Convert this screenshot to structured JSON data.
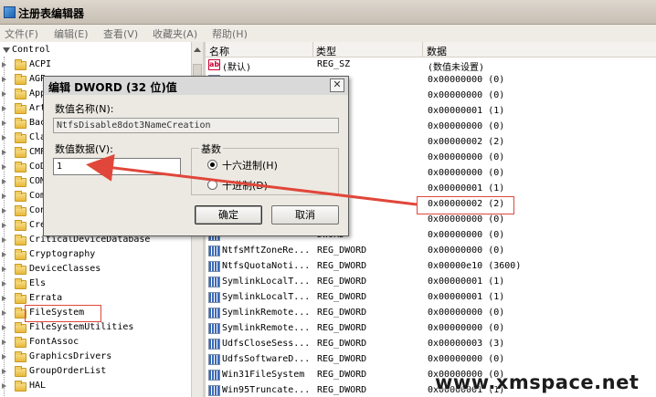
{
  "window": {
    "title": "注册表编辑器"
  },
  "menu": [
    "文件(F)",
    "编辑(E)",
    "查看(V)",
    "收藏夹(A)",
    "帮助(H)"
  ],
  "tree": {
    "root": "Control",
    "items": [
      "ACPI",
      "AGP",
      "App",
      "Art",
      "Bac",
      "Cla",
      "CMF",
      "CoD",
      "COM",
      "Com",
      "Con",
      "Cre",
      "CriticalDeviceDatabase",
      "Cryptography",
      "DeviceClasses",
      "Els",
      "Errata",
      "FileSystem",
      "FileSystemUtilities",
      "FontAssoc",
      "GraphicsDrivers",
      "GroupOrderList",
      "HAL"
    ],
    "selected": "FileSystem"
  },
  "columns": {
    "name": "名称",
    "type": "类型",
    "data": "数据"
  },
  "values": [
    {
      "name": "(默认)",
      "type": "REG_SZ",
      "data": "(数值未设置)",
      "icon": "string"
    },
    {
      "name": "",
      "type": "DWORD",
      "data": "0x00000000 (0)",
      "icon": "dword"
    },
    {
      "name": "",
      "type": "DWORD",
      "data": "0x00000000 (0)",
      "icon": "dword"
    },
    {
      "name": "",
      "type": "DWORD",
      "data": "0x00000001 (1)",
      "icon": "dword"
    },
    {
      "name": "",
      "type": "DWORD",
      "data": "0x00000000 (0)",
      "icon": "dword"
    },
    {
      "name": "",
      "type": "DWORD",
      "data": "0x00000002 (2)",
      "icon": "dword"
    },
    {
      "name": "",
      "type": "DWORD",
      "data": "0x00000000 (0)",
      "icon": "dword"
    },
    {
      "name": "",
      "type": "DWORD",
      "data": "0x00000000 (0)",
      "icon": "dword"
    },
    {
      "name": "",
      "type": "DWORD",
      "data": "0x00000001 (1)",
      "icon": "dword"
    },
    {
      "name": "",
      "type": "DWORD",
      "data": "0x00000002 (2)",
      "icon": "dword"
    },
    {
      "name": "",
      "type": "DWORD",
      "data": "0x00000000 (0)",
      "icon": "dword"
    },
    {
      "name": "",
      "type": "DWORD",
      "data": "0x00000000 (0)",
      "icon": "dword"
    },
    {
      "name": "NtfsMftZoneRe...",
      "type": "REG_DWORD",
      "data": "0x00000000 (0)",
      "icon": "dword"
    },
    {
      "name": "NtfsQuotaNoti...",
      "type": "REG_DWORD",
      "data": "0x00000e10 (3600)",
      "icon": "dword"
    },
    {
      "name": "SymlinkLocalT...",
      "type": "REG_DWORD",
      "data": "0x00000001 (1)",
      "icon": "dword"
    },
    {
      "name": "SymlinkLocalT...",
      "type": "REG_DWORD",
      "data": "0x00000001 (1)",
      "icon": "dword"
    },
    {
      "name": "SymlinkRemote...",
      "type": "REG_DWORD",
      "data": "0x00000000 (0)",
      "icon": "dword"
    },
    {
      "name": "SymlinkRemote...",
      "type": "REG_DWORD",
      "data": "0x00000000 (0)",
      "icon": "dword"
    },
    {
      "name": "UdfsCloseSess...",
      "type": "REG_DWORD",
      "data": "0x00000003 (3)",
      "icon": "dword"
    },
    {
      "name": "UdfsSoftwareD...",
      "type": "REG_DWORD",
      "data": "0x00000000 (0)",
      "icon": "dword"
    },
    {
      "name": "Win31FileSystem",
      "type": "REG_DWORD",
      "data": "0x00000000 (0)",
      "icon": "dword"
    },
    {
      "name": "Win95Truncate...",
      "type": "REG_DWORD",
      "data": "0x00000001 (1)",
      "icon": "dword"
    }
  ],
  "dialog": {
    "title": "编辑 DWORD (32 位)值",
    "close": "✕",
    "name_label": "数值名称(N):",
    "name_value": "NtfsDisable8dot3NameCreation",
    "data_label": "数值数据(V):",
    "data_value": "1",
    "base_label": "基数",
    "radio_hex": "十六进制(H)",
    "radio_dec": "十进制(D)",
    "ok": "确定",
    "cancel": "取消"
  },
  "watermark": "www.xmspace.net",
  "colors": {
    "annotation": "#e0473a"
  }
}
